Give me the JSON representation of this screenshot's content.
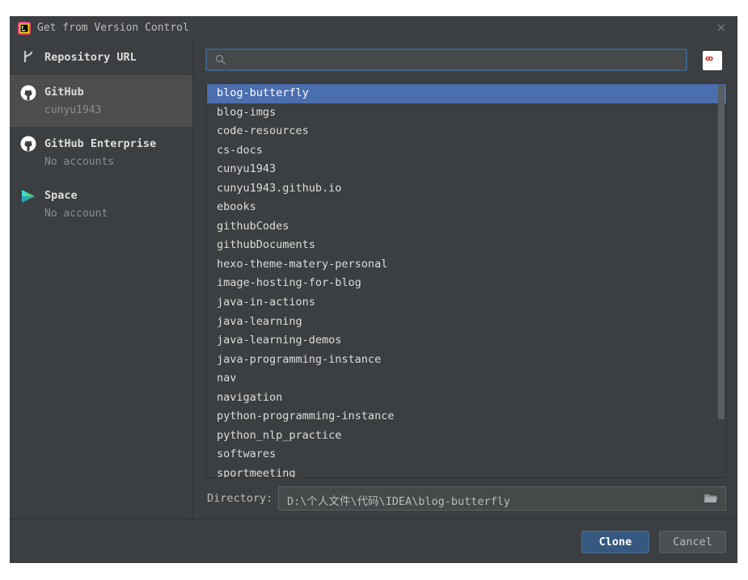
{
  "window": {
    "title": "Get from Version Control",
    "close_glyph": "×"
  },
  "sidebar": {
    "items": [
      {
        "label": "Repository URL",
        "sublabel": "",
        "icon": "vcs-branch-icon"
      },
      {
        "label": "GitHub",
        "sublabel": "cunyu1943",
        "icon": "github-icon"
      },
      {
        "label": "GitHub Enterprise",
        "sublabel": "No accounts",
        "icon": "github-icon"
      },
      {
        "label": "Space",
        "sublabel": "No account",
        "icon": "space-icon"
      }
    ],
    "selected": "GitHub"
  },
  "search": {
    "value": "",
    "placeholder": ""
  },
  "account": {
    "avatar_text": "ꝏ"
  },
  "repositories": {
    "selected": "blog-butterfly",
    "items": [
      "blog-butterfly",
      "blog-imgs",
      "code-resources",
      "cs-docs",
      "cunyu1943",
      "cunyu1943.github.io",
      "ebooks",
      "githubCodes",
      "githubDocuments",
      "hexo-theme-matery-personal",
      "image-hosting-for-blog",
      "java-in-actions",
      "java-learning",
      "java-learning-demos",
      "java-programming-instance",
      "nav",
      "navigation",
      "python-programming-instance",
      "python_nlp_practice",
      "softwares",
      "sportmeeting"
    ]
  },
  "directory": {
    "label": "Directory:",
    "value": "D:\\个人文件\\代码\\IDEA\\blog-butterfly"
  },
  "buttons": {
    "clone": "Clone",
    "cancel": "Cancel"
  },
  "colors": {
    "selection": "#4b6eaf",
    "background": "#3c3f41",
    "primary_button": "#365880",
    "focus_border": "#3d6185"
  }
}
